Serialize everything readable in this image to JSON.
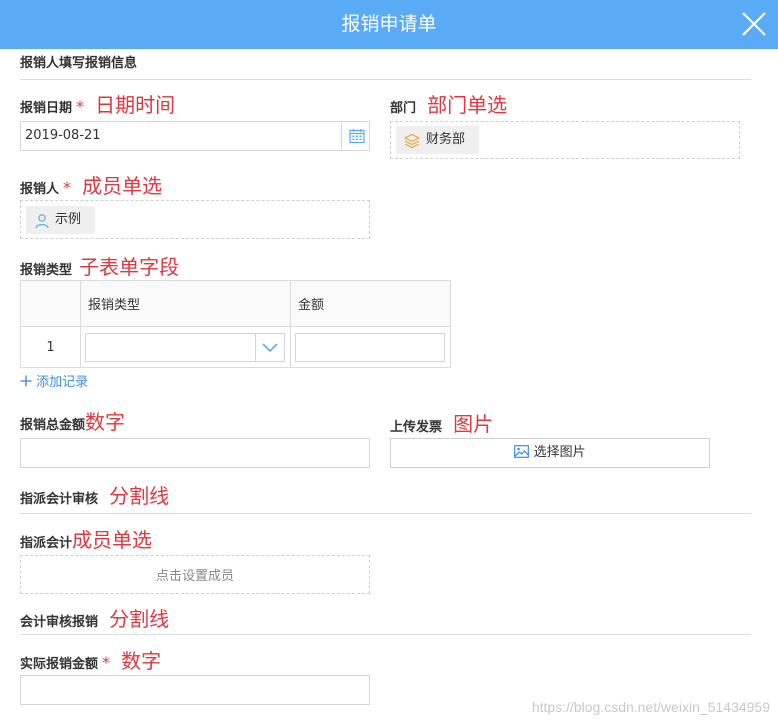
{
  "header": {
    "title": "报销申请单"
  },
  "section1": {
    "title": "报销人填写报销信息"
  },
  "date_field": {
    "label": "报销日期",
    "required": "*",
    "note": "日期时间",
    "value": "2019-08-21"
  },
  "dept_field": {
    "label": "部门",
    "note": "部门单选",
    "chip": "财务部"
  },
  "person_field": {
    "label": "报销人",
    "required": "*",
    "note": "成员单选",
    "chip": "示例"
  },
  "type_field": {
    "label": "报销类型",
    "note": "子表单字段",
    "columns": [
      "",
      "报销类型",
      "金额"
    ],
    "rows": [
      {
        "index": "1",
        "type": "",
        "amount": ""
      }
    ],
    "add_label": "添加记录"
  },
  "total_field": {
    "label": "报销总金额",
    "note": "数字",
    "value": ""
  },
  "invoice_field": {
    "label": "上传发票",
    "note": "图片",
    "button": "选择图片"
  },
  "section2": {
    "title": "指派会计审核",
    "note": "分割线"
  },
  "accountant_field": {
    "label": "指派会计",
    "note": "成员单选",
    "button": "点击设置成员"
  },
  "section3": {
    "title": "会计审核报销",
    "note": "分割线"
  },
  "actual_field": {
    "label": "实际报销金额",
    "required": "*",
    "note": "数字",
    "value": ""
  },
  "watermark": "https://blog.csdn.net/weixin_51434959",
  "colors": {
    "header": "#5aabf5",
    "note_red": "#e0373e",
    "link_blue": "#3a8ee6"
  }
}
